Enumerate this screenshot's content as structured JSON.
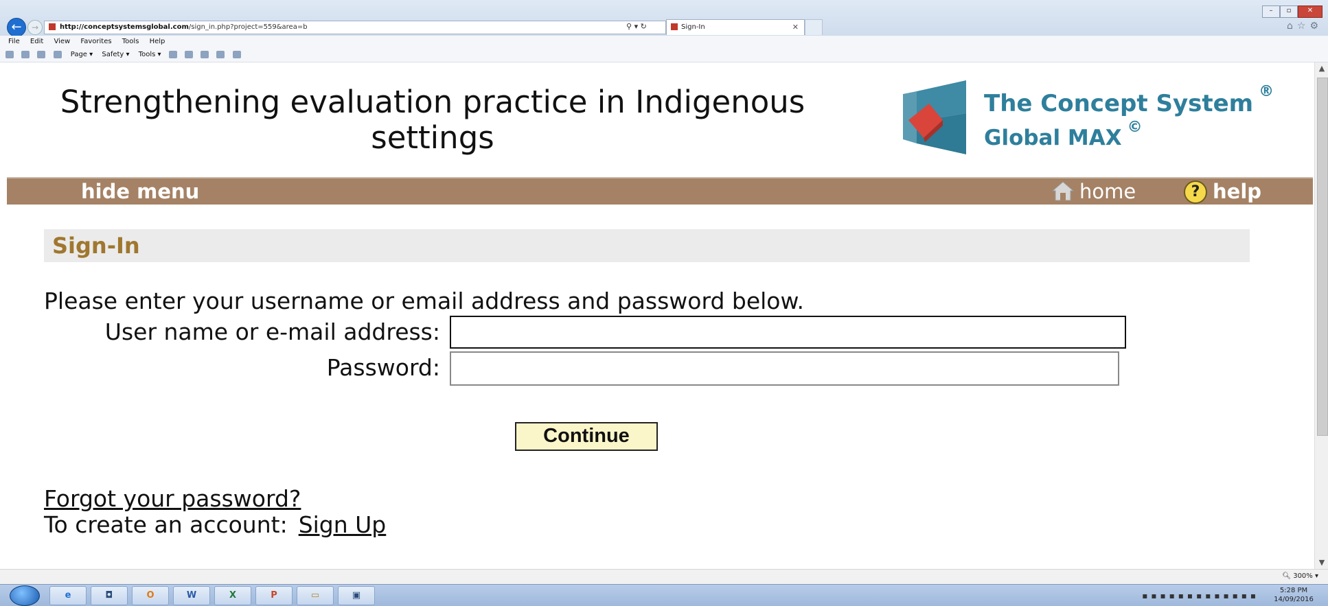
{
  "browser": {
    "url_domain": "http://conceptsystemsglobal.com",
    "url_path": "/sign_in.php?project=559&area=b",
    "tab_title": "Sign-In",
    "menu": [
      "File",
      "Edit",
      "View",
      "Favorites",
      "Tools",
      "Help"
    ],
    "command_bar": [
      "Page ▾",
      "Safety ▾",
      "Tools ▾"
    ]
  },
  "header": {
    "site_title": "Strengthening evaluation practice in Indigenous settings",
    "brand_line1": "The Concept System",
    "brand_line1_mark": "®",
    "brand_line2": "Global MAX",
    "brand_line2_mark": "©",
    "brand_color": "#2e7f9c"
  },
  "nav": {
    "hide_menu": "hide menu",
    "home": "home",
    "help": "help",
    "strip_color": "#a58265"
  },
  "signin": {
    "title": "Sign-In",
    "intro": "Please enter your username or email address and password below.",
    "user_label": "User name or e-mail address:",
    "user_value": "",
    "password_label": "Password:",
    "password_value": "",
    "continue_label": "Continue",
    "forgot_link": "Forgot your password?",
    "create_text": "To create an account:",
    "signup_link": "Sign Up"
  },
  "status": {
    "zoom": "300%"
  },
  "taskbar": {
    "time": "5:28 PM",
    "date": "14/09/2016"
  }
}
